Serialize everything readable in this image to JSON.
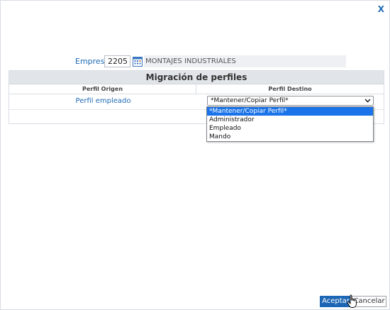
{
  "dialog": {
    "close_label": "X"
  },
  "empresa": {
    "label": "Empresa",
    "code": "2205",
    "name": "MONTAJES INDUSTRIALES",
    "lookup_icon": "calendar-grid-icon"
  },
  "panel": {
    "title": "Migración de perfiles",
    "columns": {
      "origin": "Perfil Origen",
      "destination": "Perfil Destino"
    },
    "row": {
      "origin_label": "Perfil empleado",
      "selected_value": "*Mantener/Copiar Perfil*"
    }
  },
  "dropdown": {
    "options": [
      "*Mantener/Copiar Perfil*",
      "Administrador",
      "Empleado",
      "Mando"
    ],
    "highlighted_index": 0
  },
  "buttons": {
    "accept": "Aceptar",
    "cancel": "Cancelar"
  },
  "colors": {
    "accent": "#1f6bb5",
    "accept_button": "#1c67b5",
    "dropdown_highlight": "#1a73e8",
    "panel_header": "#e1e5ea"
  }
}
